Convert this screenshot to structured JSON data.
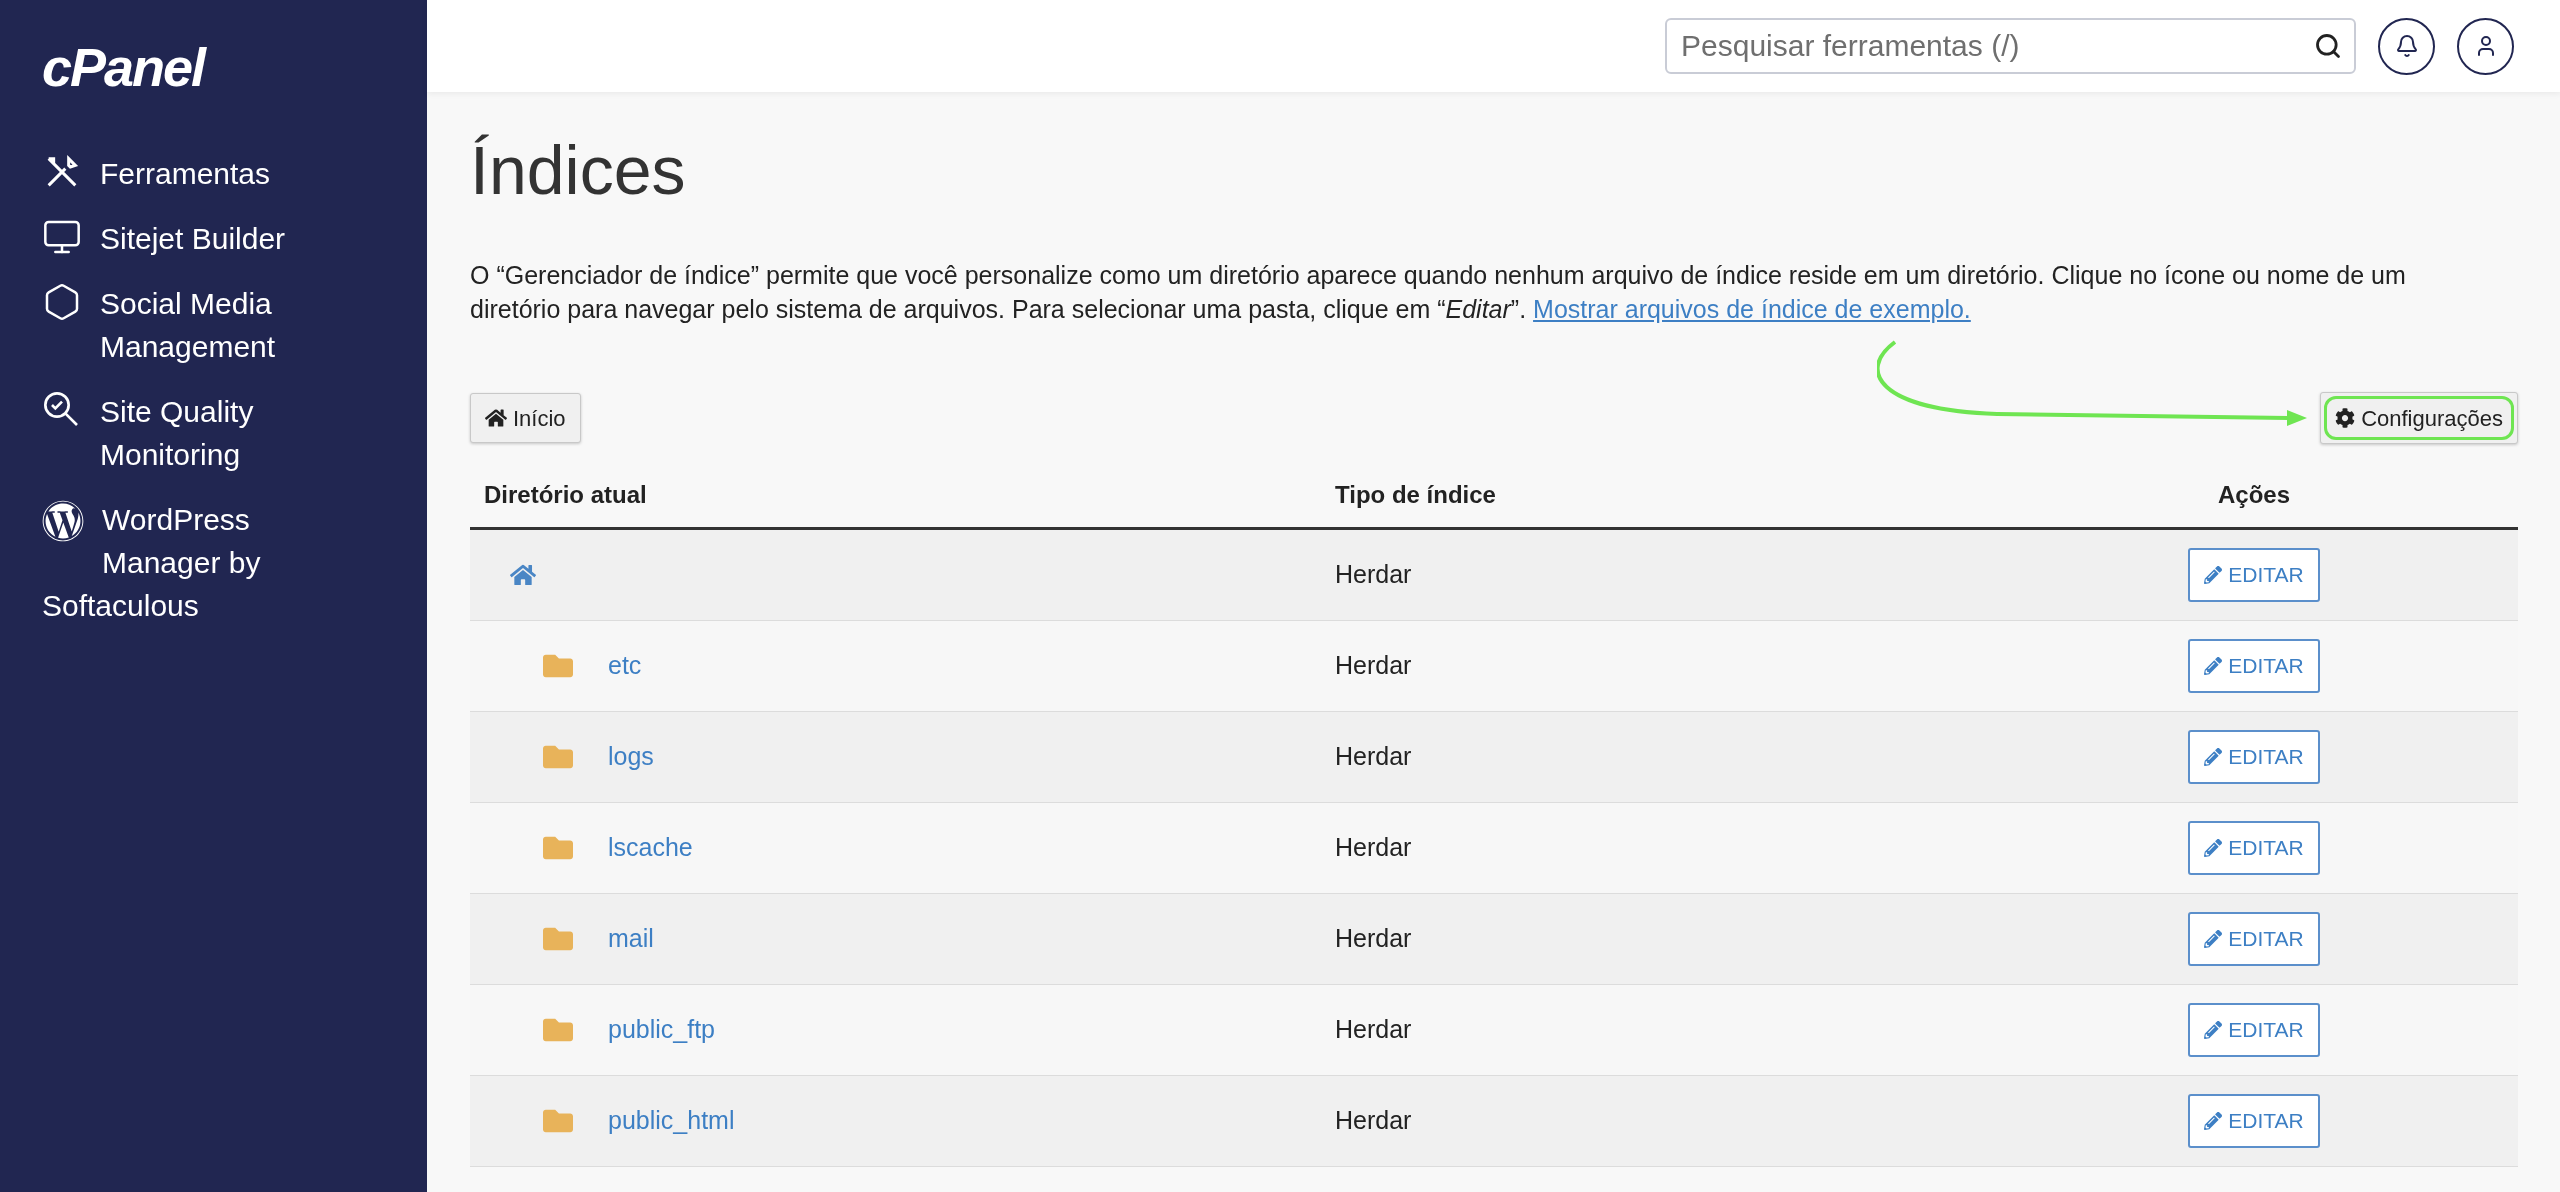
{
  "sidebar": {
    "logo": "cPanel",
    "items": [
      {
        "label": "Ferramentas"
      },
      {
        "label": "Sitejet Builder"
      },
      {
        "label": "Social Media Management"
      },
      {
        "label": "Site Quality Monitoring"
      },
      {
        "label": "WordPress Manager by Softaculous"
      }
    ]
  },
  "header": {
    "search": {
      "placeholder": "Pesquisar ferramentas (/)"
    }
  },
  "page": {
    "title": "Índices",
    "description": "O “Gerenciador de índice” permite que você personalize como um diretório aparece quando nenhum arquivo de índice reside em um diretório. Clique no ícone ou nome de um diretório para navegar pelo sistema de arquivos. Para selecionar uma pasta, clique em “*Editar*”.",
    "description_link": "Mostrar arquivos de índice de exemplo.",
    "home_button": "Início",
    "settings_button": "Configurações"
  },
  "table": {
    "columns": [
      "Diretório atual",
      "Tipo de índice",
      "Ações"
    ],
    "rows": [
      {
        "kind": "home",
        "index_type": "Herdar",
        "action": "EDITAR"
      },
      {
        "kind": "folder",
        "name": "etc",
        "index_type": "Herdar",
        "action": "EDITAR"
      },
      {
        "kind": "folder",
        "name": "logs",
        "index_type": "Herdar",
        "action": "EDITAR"
      },
      {
        "kind": "folder",
        "name": "lscache",
        "index_type": "Herdar",
        "action": "EDITAR"
      },
      {
        "kind": "folder",
        "name": "mail",
        "index_type": "Herdar",
        "action": "EDITAR"
      },
      {
        "kind": "folder",
        "name": "public_ftp",
        "index_type": "Herdar",
        "action": "EDITAR"
      },
      {
        "kind": "folder",
        "name": "public_html",
        "index_type": "Herdar",
        "action": "EDITAR"
      }
    ]
  }
}
